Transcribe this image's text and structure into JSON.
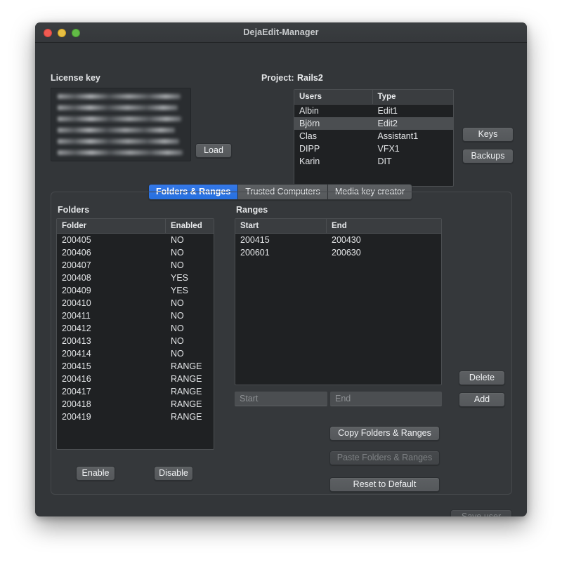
{
  "window": {
    "title": "DejaEdit-Manager",
    "traffic_lights": [
      "close-button",
      "minimize-button",
      "zoom-button"
    ]
  },
  "license": {
    "label": "License key",
    "obscured_lines": 6,
    "load_label": "Load"
  },
  "project": {
    "label": "Project:",
    "name": "Rails2"
  },
  "users": {
    "columns": [
      "Users",
      "Type"
    ],
    "rows": [
      {
        "user": "Albin",
        "type": "Edit1",
        "selected": false
      },
      {
        "user": "Björn",
        "type": "Edit2",
        "selected": true
      },
      {
        "user": "Clas",
        "type": "Assistant1",
        "selected": false
      },
      {
        "user": "DIPP",
        "type": "VFX1",
        "selected": false
      },
      {
        "user": "Karin",
        "type": "DIT",
        "selected": false
      }
    ],
    "keys_label": "Keys",
    "backups_label": "Backups"
  },
  "tabs": [
    {
      "label": "Folders & Ranges",
      "active": true
    },
    {
      "label": "Trusted Computers",
      "active": false
    },
    {
      "label": "Media key creator",
      "active": false
    }
  ],
  "folders": {
    "title": "Folders",
    "columns": [
      "Folder",
      "Enabled"
    ],
    "rows": [
      {
        "folder": "200405",
        "enabled": "NO"
      },
      {
        "folder": "200406",
        "enabled": "NO"
      },
      {
        "folder": "200407",
        "enabled": "NO"
      },
      {
        "folder": "200408",
        "enabled": "YES"
      },
      {
        "folder": "200409",
        "enabled": "YES"
      },
      {
        "folder": "200410",
        "enabled": "NO"
      },
      {
        "folder": "200411",
        "enabled": "NO"
      },
      {
        "folder": "200412",
        "enabled": "NO"
      },
      {
        "folder": "200413",
        "enabled": "NO"
      },
      {
        "folder": "200414",
        "enabled": "NO"
      },
      {
        "folder": "200415",
        "enabled": "RANGE"
      },
      {
        "folder": "200416",
        "enabled": "RANGE"
      },
      {
        "folder": "200417",
        "enabled": "RANGE"
      },
      {
        "folder": "200418",
        "enabled": "RANGE"
      },
      {
        "folder": "200419",
        "enabled": "RANGE"
      }
    ],
    "enable_label": "Enable",
    "disable_label": "Disable"
  },
  "ranges": {
    "title": "Ranges",
    "columns": [
      "Start",
      "End"
    ],
    "rows": [
      {
        "start": "200415",
        "end": "200430"
      },
      {
        "start": "200601",
        "end": "200630"
      }
    ],
    "start_placeholder": "Start",
    "start_value": "",
    "end_placeholder": "End",
    "end_value": "",
    "delete_label": "Delete",
    "add_label": "Add"
  },
  "actions": {
    "copy_label": "Copy Folders & Ranges",
    "paste_label": "Paste Folders & Ranges",
    "paste_disabled": true,
    "reset_label": "Reset to Default"
  },
  "footer": {
    "save_label": "Save user",
    "save_disabled": true
  },
  "colors": {
    "window_bg": "#333639",
    "table_bg": "#1f2123",
    "accent_blue": "#3578e8",
    "selection": "#4b4e51",
    "text": "#e4e6e8",
    "disabled_text": "#7d8083"
  }
}
